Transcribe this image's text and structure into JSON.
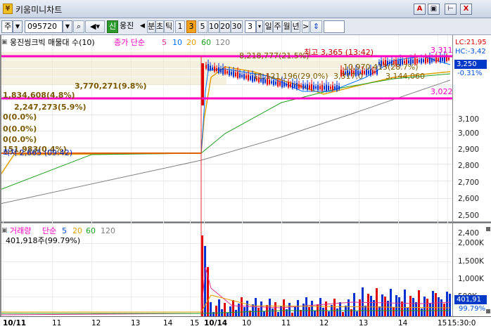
{
  "window": {
    "title": "키움미니차트",
    "buttons": [
      "A",
      "▣",
      "⊢",
      "X"
    ]
  },
  "toolbar": {
    "market": "주",
    "code": "095720",
    "stock_name": "웅진",
    "sin_label": "신",
    "prev": "◀",
    "period_buttons": [
      "분",
      "초",
      "틱",
      "1",
      "3",
      "5",
      "10",
      "20",
      "30"
    ],
    "active_period": "3",
    "interval_value": "3",
    "range_buttons": [
      "일",
      "주",
      "월",
      "년"
    ],
    "next": ">",
    "updown": "⇕"
  },
  "price_panel": {
    "header": {
      "name": "웅진씽크빅 매물대 수(10)",
      "ma_label": "종가 단순",
      "ma_periods": [
        "5",
        "10",
        "20",
        "60",
        "120"
      ],
      "ma_colors": [
        "#0070ff",
        "#0070ff",
        "#e0a000",
        "#20a020",
        "#808080"
      ]
    },
    "annotations": {
      "high": "최고 3,365 (13:42)",
      "low": "최저 2,665 (09:42)",
      "level_3311": "3,311",
      "level_3022": "3,022",
      "vp_8218777": "8,218,777(21.5%)",
      "vp_10970413": "10,970,413(28.7%)",
      "vp_11121196": "11,121,196(29.0%)",
      "vp_3317": "3,317,0",
      "vp_3144060": "3,144,060",
      "vp_3770271": "3,770,271(9.8%)",
      "vp_1834608": "1,834,608(4.8%)",
      "vp_2247273": "2,247,273(5.9%)",
      "vp_zero1": "0(0.0%)",
      "vp_zero2": "0(0.0%)",
      "vp_zero3": "0(0.0%)",
      "vp_151983": "151,983(0.4%)"
    },
    "right_labels": {
      "lc": "LC:21,95",
      "hc": "HC:-3,42",
      "price": "3,250",
      "pct": "-0.31%"
    },
    "y_ticks": [
      "3,100",
      "3,000",
      "2,900",
      "2,800",
      "2,700",
      "2,600",
      "2,500",
      "2,400"
    ]
  },
  "volume_panel": {
    "header": {
      "name": "거래량",
      "ma_label": "단순",
      "ma_periods": [
        "5",
        "20",
        "60",
        "120"
      ]
    },
    "current": "401,918주(99.79%)",
    "right_labels": {
      "vol": "401,91",
      "pct": "99.79%"
    },
    "y_ticks": [
      "2,000K",
      "1,500K",
      "1,000K",
      "500K"
    ]
  },
  "x_axis": {
    "labels": [
      "10/11",
      "11",
      "12",
      "13",
      "14",
      "15",
      "10/14",
      "10",
      "11",
      "12",
      "13",
      "14",
      "15",
      "15:30:0"
    ]
  },
  "colors": {
    "magenta": "#ff00c0",
    "orange": "#e06000",
    "brown_text": "#7a5a00"
  }
}
